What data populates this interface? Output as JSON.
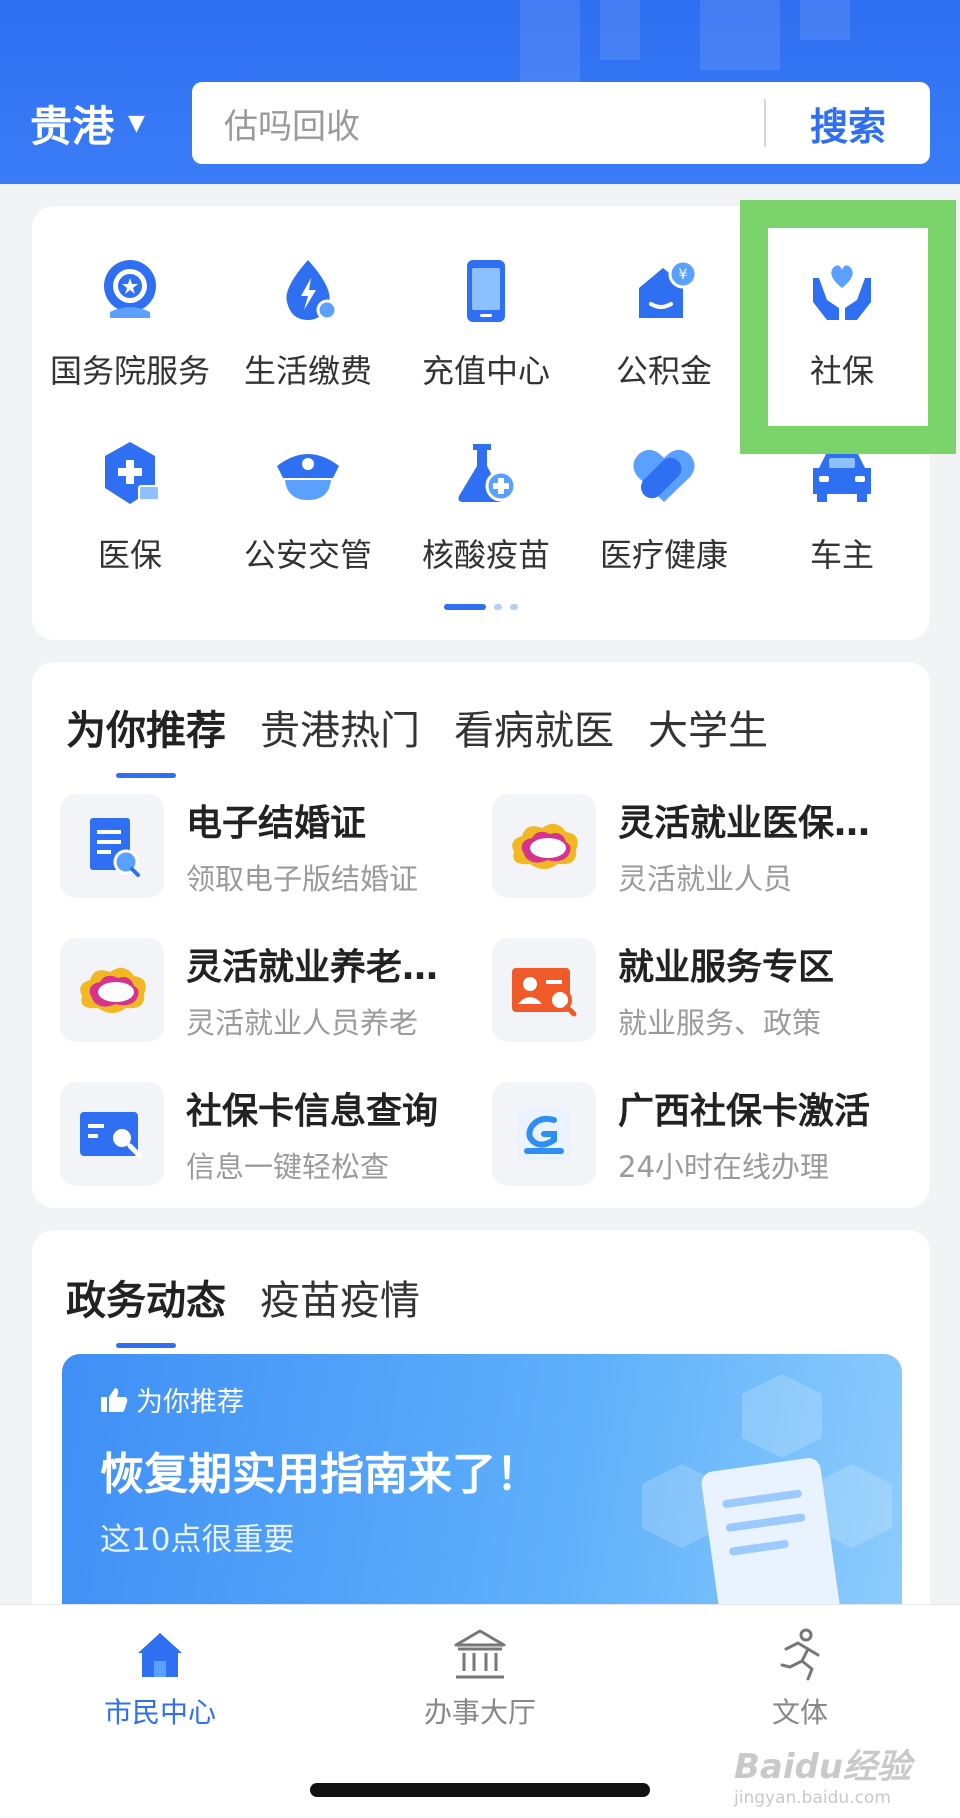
{
  "header": {
    "city": "贵港",
    "search_placeholder": "估吗回收",
    "search_button": "搜索"
  },
  "services": {
    "items": [
      {
        "label": "国务院服务",
        "icon": "state-council-icon"
      },
      {
        "label": "生活缴费",
        "icon": "utility-bill-icon"
      },
      {
        "label": "充值中心",
        "icon": "phone-recharge-icon"
      },
      {
        "label": "公积金",
        "icon": "housing-fund-icon"
      },
      {
        "label": "社保",
        "icon": "social-security-icon"
      },
      {
        "label": "医保",
        "icon": "medical-insurance-icon"
      },
      {
        "label": "公安交管",
        "icon": "police-traffic-icon"
      },
      {
        "label": "核酸疫苗",
        "icon": "nucleic-vaccine-icon"
      },
      {
        "label": "医疗健康",
        "icon": "medical-health-icon"
      },
      {
        "label": "车主",
        "icon": "car-owner-icon"
      }
    ],
    "page_indicator": {
      "pages": 3,
      "current": 1
    }
  },
  "recommend": {
    "tabs": [
      "为你推荐",
      "贵港热门",
      "看病就医",
      "大学生"
    ],
    "active_tab": 0,
    "items": [
      {
        "title": "电子结婚证",
        "subtitle": "领取电子版结婚证",
        "icon": "marriage-certificate-icon"
      },
      {
        "title": "灵活就业医保…",
        "subtitle": "灵活就业人员",
        "icon": "cloud-logo-icon"
      },
      {
        "title": "灵活就业养老…",
        "subtitle": "灵活就业人员养老",
        "icon": "cloud-logo-icon"
      },
      {
        "title": "就业服务专区",
        "subtitle": "就业服务、政策",
        "icon": "employment-card-icon"
      },
      {
        "title": "社保卡信息查询",
        "subtitle": "信息一键轻松查",
        "icon": "card-search-icon"
      },
      {
        "title": "广西社保卡激活",
        "subtitle": "24小时在线办理",
        "icon": "guangxi-social-card-icon"
      }
    ]
  },
  "news": {
    "tabs": [
      "政务动态",
      "疫苗疫情"
    ],
    "active_tab": 0,
    "banner": {
      "tag": "为你推荐",
      "headline": "恢复期实用指南来了！",
      "subtitle": "这10点很重要"
    }
  },
  "bottom_nav": {
    "items": [
      {
        "label": "市民中心",
        "icon": "home-icon",
        "active": true
      },
      {
        "label": "办事大厅",
        "icon": "government-hall-icon",
        "active": false
      },
      {
        "label": "文体",
        "icon": "running-person-icon",
        "active": false
      }
    ]
  },
  "colors": {
    "primary": "#2f6ff2",
    "highlight": "#7bd36c",
    "background": "#f2f3f5"
  },
  "watermark": {
    "text": "Baidu经验",
    "url": "jingyan.baidu.com"
  }
}
